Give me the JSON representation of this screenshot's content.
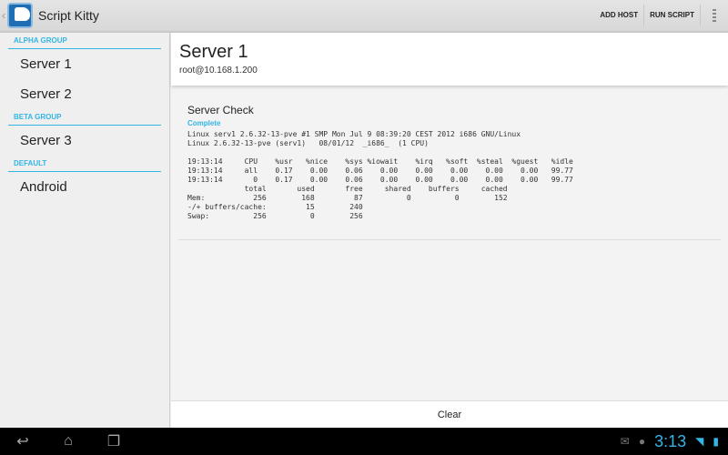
{
  "app": {
    "title": "Script Kitty"
  },
  "actions": {
    "add_host": "ADD HOST",
    "run_script": "RUN SCRIPT"
  },
  "sidebar": {
    "groups": [
      {
        "name": "ALPHA GROUP",
        "items": [
          "Server 1",
          "Server 2"
        ]
      },
      {
        "name": "BETA GROUP",
        "items": [
          "Server 3"
        ]
      },
      {
        "name": "DEFAULT",
        "items": [
          "Android"
        ]
      }
    ]
  },
  "server": {
    "name": "Server 1",
    "address": "root@10.168.1.200"
  },
  "check": {
    "title": "Server Check",
    "status": "Complete",
    "output": "Linux serv1 2.6.32-13-pve #1 SMP Mon Jul 9 08:39:20 CEST 2012 i686 GNU/Linux\nLinux 2.6.32-13-pve (serv1)   08/01/12  _i686_  (1 CPU)\n\n19:13:14     CPU    %usr   %nice    %sys %iowait    %irq   %soft  %steal  %guest   %idle\n19:13:14     all    0.17    0.00    0.06    0.00    0.00    0.00    0.00    0.00   99.77\n19:13:14       0    0.17    0.00    0.06    0.00    0.00    0.00    0.00    0.00   99.77\n             total       used       free     shared    buffers     cached\nMem:           256        168         87          0          0        152\n-/+ buffers/cache:         15        240\nSwap:          256          0        256"
  },
  "footer": {
    "clear": "Clear"
  },
  "statusbar": {
    "time": "3:13"
  }
}
